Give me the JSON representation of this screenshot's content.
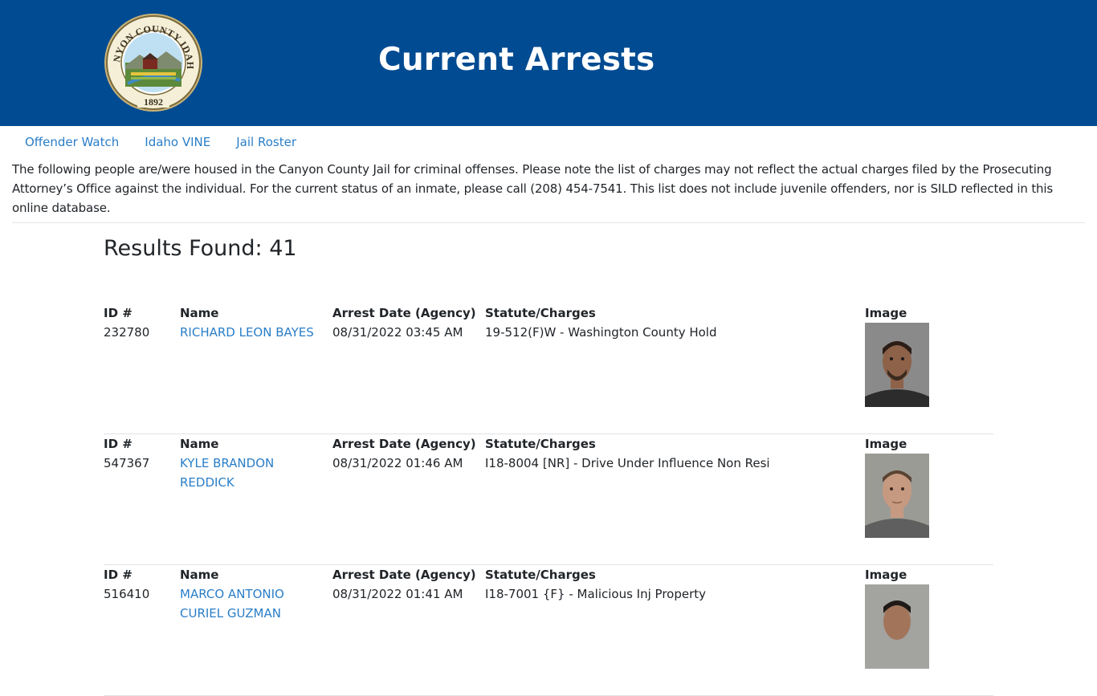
{
  "header": {
    "seal": {
      "text_top": "CANYON COUNTY IDAHO",
      "year": "1892"
    },
    "title": "Current Arrests"
  },
  "nav": [
    {
      "label": "Offender Watch"
    },
    {
      "label": "Idaho VINE"
    },
    {
      "label": "Jail Roster"
    }
  ],
  "notice": "The following people are/were housed in the Canyon County Jail for criminal offenses. Please note the list of charges may not reflect the actual charges filed by the Prosecuting Attorney’s Office against the individual. For the current status of an inmate, please call (208) 454-7541. This list does not include juvenile offenders, nor is SILD reflected in this online database.",
  "results": "Results Found: 41",
  "columns": {
    "id": "ID #",
    "name": "Name",
    "date": "Arrest Date (Agency)",
    "charges": "Statute/Charges",
    "image": "Image"
  },
  "records": [
    {
      "id": "232780",
      "name": "RICHARD LEON BAYES",
      "date": "08/31/2022 03:45 AM",
      "charges": "19-512(F)W - Washington County Hold",
      "photo_colors": {
        "bg": "#8a8a8a",
        "skin": "#8d6249",
        "hair": "#2b1d16",
        "shirt": "#2c2c2c"
      }
    },
    {
      "id": "547367",
      "name": "KYLE BRANDON REDDICK",
      "date": "08/31/2022 01:46 AM",
      "charges": "I18-8004 [NR] - Drive Under Influence Non Resi",
      "photo_colors": {
        "bg": "#9b9b96",
        "skin": "#c69a80",
        "hair": "#5a4332",
        "shirt": "#5e5f5e"
      }
    },
    {
      "id": "516410",
      "name": "MARCO ANTONIO CURIEL GUZMAN",
      "date": "08/31/2022 01:41 AM",
      "charges": "I18-7001 {F} - Malicious Inj Property",
      "photo_colors": {
        "bg": "#a3a3a0",
        "skin": "#a2755a",
        "hair": "#1f1a17",
        "shirt": "#3d3d3d"
      }
    }
  ]
}
